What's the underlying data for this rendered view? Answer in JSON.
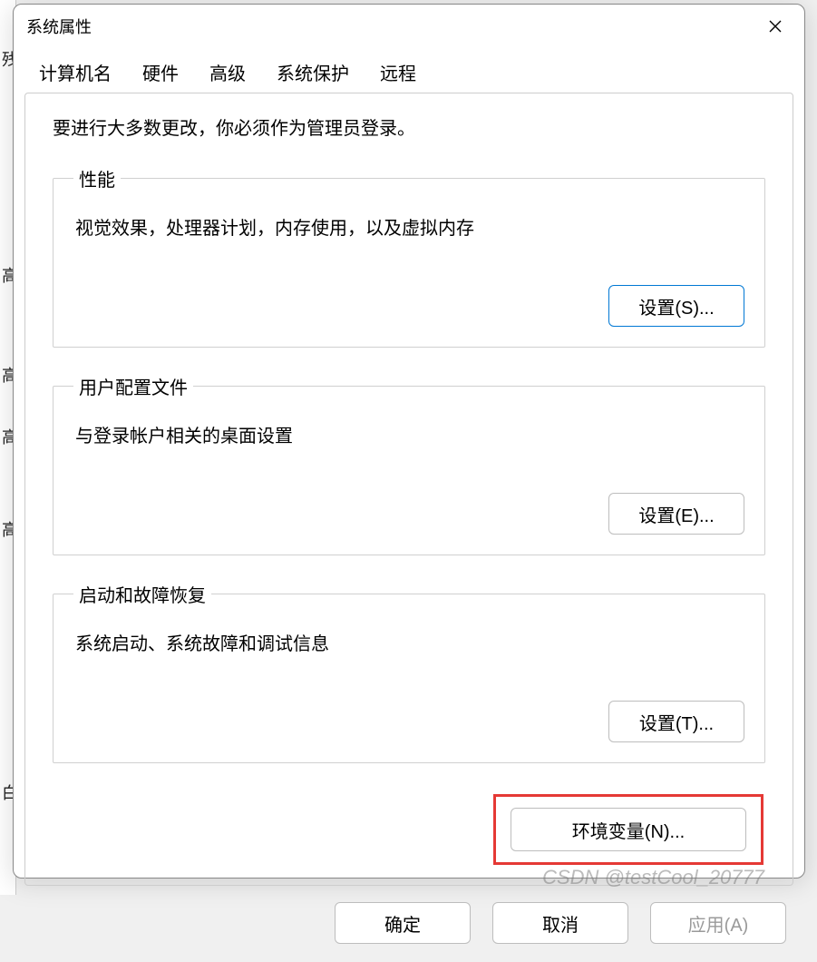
{
  "dialog": {
    "title": "系统属性",
    "close_icon": "close-icon"
  },
  "tabs": {
    "items": [
      {
        "label": "计算机名",
        "active": false
      },
      {
        "label": "硬件",
        "active": false
      },
      {
        "label": "高级",
        "active": true
      },
      {
        "label": "系统保护",
        "active": false
      },
      {
        "label": "远程",
        "active": false
      }
    ]
  },
  "intro": "要进行大多数更改，你必须作为管理员登录。",
  "groups": [
    {
      "legend": "性能",
      "desc": "视觉效果，处理器计划，内存使用，以及虚拟内存",
      "button": "设置(S)...",
      "button_focused": true
    },
    {
      "legend": "用户配置文件",
      "desc": "与登录帐户相关的桌面设置",
      "button": "设置(E)...",
      "button_focused": false
    },
    {
      "legend": "启动和故障恢复",
      "desc": "系统启动、系统故障和调试信息",
      "button": "设置(T)...",
      "button_focused": false
    }
  ],
  "env_button": "环境变量(N)...",
  "footer": {
    "ok": "确定",
    "cancel": "取消",
    "apply": "应用(A)",
    "apply_enabled": false
  },
  "watermark": "CSDN @testCool_20777"
}
